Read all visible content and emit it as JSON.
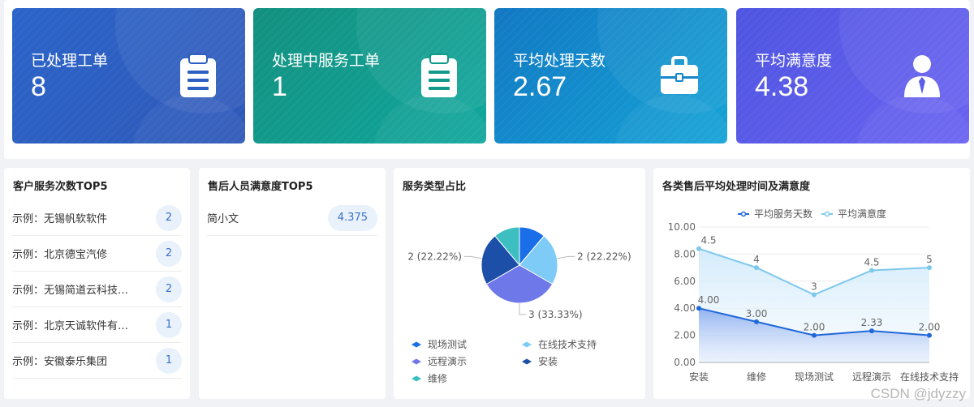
{
  "stats": [
    {
      "label": "已处理工单",
      "value": "8",
      "icon": "clipboard-icon"
    },
    {
      "label": "处理中服务工单",
      "value": "1",
      "icon": "clipboard-icon"
    },
    {
      "label": "平均处理天数",
      "value": "2.67",
      "icon": "briefcase-icon"
    },
    {
      "label": "平均满意度",
      "value": "4.38",
      "icon": "user-icon"
    }
  ],
  "customer_top5": {
    "title": "客户服务次数TOP5",
    "items": [
      {
        "name": "示例：无锡帆软软件",
        "count": "2"
      },
      {
        "name": "示例：北京德宝汽修",
        "count": "2"
      },
      {
        "name": "示例：无锡简道云科技…",
        "count": "2"
      },
      {
        "name": "示例：北京天诚软件有…",
        "count": "1"
      },
      {
        "name": "示例：安徽泰乐集团",
        "count": "1"
      }
    ]
  },
  "staff_top5": {
    "title": "售后人员满意度TOP5",
    "items": [
      {
        "name": "简小文",
        "score": "4.375"
      }
    ]
  },
  "pie": {
    "title": "服务类型占比",
    "chart_data": {
      "type": "pie",
      "slices": [
        {
          "name": "现场测试",
          "value": 1,
          "color": "#1a6fe8"
        },
        {
          "name": "在线技术支持",
          "value": 2,
          "color": "#7ecbf8",
          "label": "2 (22.22%)"
        },
        {
          "name": "远程演示",
          "value": 3,
          "color": "#6e78e8",
          "label": "3 (33.33%)"
        },
        {
          "name": "安装",
          "value": 2,
          "color": "#1c4fa8",
          "label": "2 (22.22%)"
        },
        {
          "name": "维修",
          "value": 1,
          "color": "#3dbfc2"
        }
      ]
    }
  },
  "combo": {
    "title": "各类售后平均处理时间及满意度",
    "chart_data": {
      "type": "line",
      "categories": [
        "安装",
        "维修",
        "现场测试",
        "远程演示",
        "在线技术支持"
      ],
      "yaxis_ticks": [
        "0.00",
        "2.00",
        "4.00",
        "6.00",
        "8.00",
        "10.00"
      ],
      "ylim": [
        0,
        10
      ],
      "series": [
        {
          "name": "平均服务天数",
          "values": [
            4,
            3,
            2,
            2.33,
            2
          ],
          "labels": [
            "4.00",
            "3.00",
            "2.00",
            "2.33",
            "2.00"
          ],
          "color": "#2268d8"
        },
        {
          "name": "平均满意度",
          "values": [
            8.4,
            7.0,
            5.0,
            6.8,
            7.0
          ],
          "labels": [
            "4.5",
            "4",
            "3",
            "4.5",
            "5"
          ],
          "color": "#7ec8ec"
        }
      ]
    }
  },
  "watermark": "CSDN @jdyzzy"
}
